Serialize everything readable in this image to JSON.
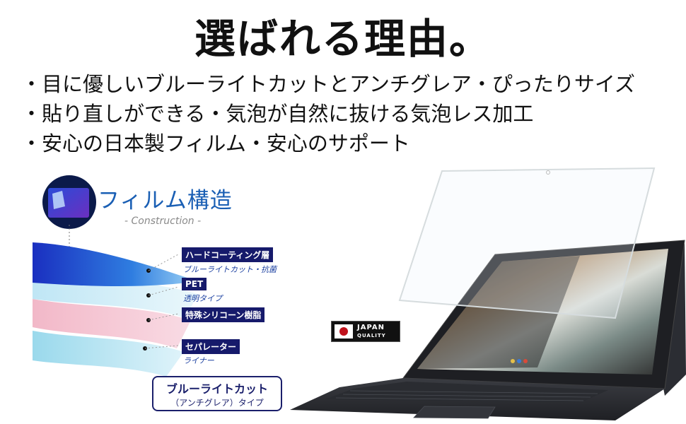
{
  "headline": "選ばれる理由。",
  "bullets": [
    "・目に優しいブルーライトカットとアンチグレア・ぴったりサイズ",
    "・貼り直しができる・気泡が自然に抜ける気泡レス加工",
    "・安心の日本製フィルム・安心のサポート"
  ],
  "diagram": {
    "title": "フィルム構造",
    "subtitle": "- Construction -",
    "layers": [
      {
        "label": "ハードコーティング層",
        "desc": "ブルーライトカット・抗菌"
      },
      {
        "label": "PET",
        "desc": "透明タイプ"
      },
      {
        "label": "特殊シリコーン樹脂",
        "desc": ""
      },
      {
        "label": "セパレーター",
        "desc": "ライナー"
      }
    ],
    "type_box": {
      "main": "ブルーライトカット",
      "sub": "（アンチグレア）タイプ"
    }
  },
  "badge": {
    "line1": "JAPAN",
    "line2": "QUALITY"
  },
  "colors": {
    "navy": "#161a6b",
    "accent_blue": "#1a5fb4",
    "flag_red": "#c0121c"
  }
}
